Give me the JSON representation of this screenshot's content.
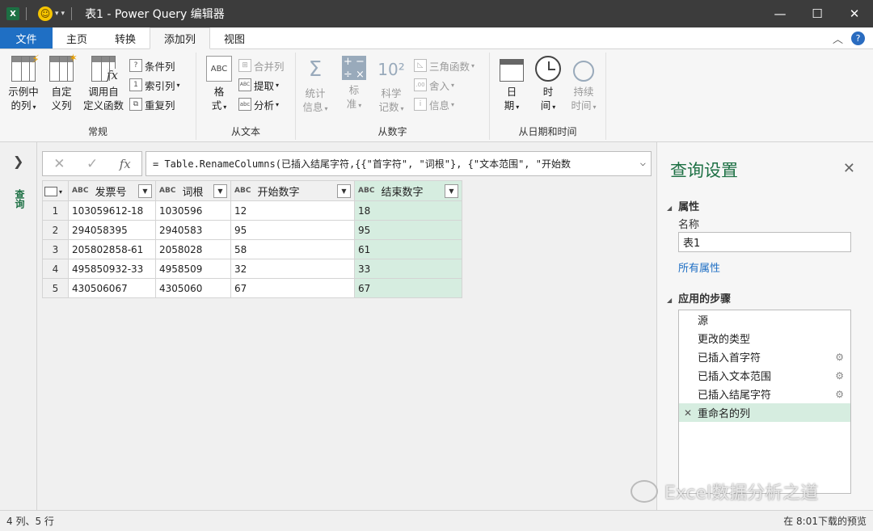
{
  "window": {
    "title": "表1 - Power Query 编辑器",
    "app_icon": "X",
    "minimize": "—",
    "maximize": "☐",
    "close": "✕"
  },
  "tabs": {
    "file": "文件",
    "home": "主页",
    "transform": "转换",
    "add_column": "添加列",
    "view": "视图",
    "active": "添加列"
  },
  "ribbon": {
    "general": {
      "label": "常规",
      "example_column": [
        "示例中",
        "的列"
      ],
      "custom_column": [
        "自定",
        "义列"
      ],
      "invoke_function": [
        "调用自",
        "定义函数"
      ],
      "conditional_column": "条件列",
      "index_column": "索引列",
      "duplicate_column": "重复列"
    },
    "from_text": {
      "label": "从文本",
      "format": [
        "格",
        "式"
      ],
      "merge_columns": "合并列",
      "extract": "提取",
      "parse": "分析",
      "abc_text": "ABC",
      "abc123_text": "ABC\n123"
    },
    "from_number": {
      "label": "从数字",
      "statistics": [
        "统计",
        "信息"
      ],
      "standard": [
        "标",
        "准"
      ],
      "scientific": [
        "科学",
        "记数"
      ],
      "trigonometry": "三角函数",
      "rounding": "舍入",
      "information": "信息"
    },
    "from_datetime": {
      "label": "从日期和时间",
      "date": [
        "日",
        "期"
      ],
      "time": [
        "时",
        "间"
      ],
      "duration": [
        "持续",
        "时间"
      ]
    }
  },
  "formula": {
    "text": "= Table.RenameColumns(已插入结尾字符,{{\"首字符\", \"词根\"}, {\"文本范围\", \"开始数"
  },
  "table": {
    "columns": [
      "发票号",
      "词根",
      "开始数字",
      "结束数字"
    ],
    "type_badge": "ABC",
    "rows": [
      [
        "1",
        "103059612-18",
        "1030596",
        "12",
        "18"
      ],
      [
        "2",
        "294058395",
        "2940583",
        "95",
        "95"
      ],
      [
        "3",
        "205802858-61",
        "2058028",
        "58",
        "61"
      ],
      [
        "4",
        "495850932-33",
        "4958509",
        "32",
        "33"
      ],
      [
        "5",
        "430506067",
        "4305060",
        "67",
        "67"
      ]
    ]
  },
  "leftnav": {
    "label": "查询"
  },
  "settings": {
    "title": "查询设置",
    "properties_header": "属性",
    "name_label": "名称",
    "name_value": "表1",
    "all_properties": "所有属性",
    "steps_header": "应用的步骤",
    "steps": [
      "源",
      "更改的类型",
      "已插入首字符",
      "已插入文本范围",
      "已插入结尾字符",
      "重命名的列"
    ]
  },
  "watermark": "Excel数据分析之道",
  "status": {
    "left": "4 列、5 行",
    "right": "在 8:01下载的预览"
  }
}
